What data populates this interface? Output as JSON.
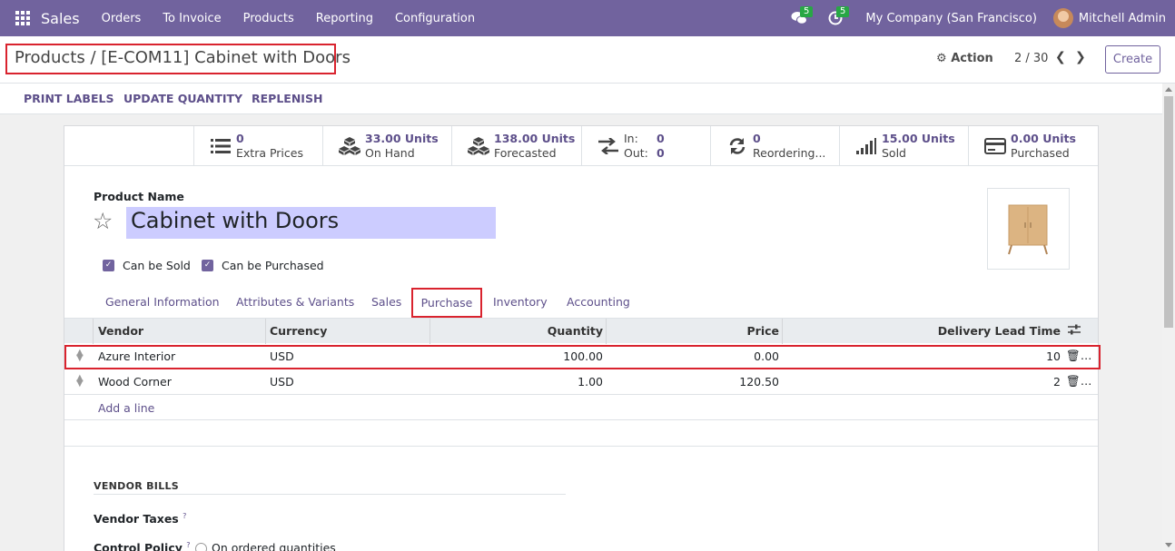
{
  "navbar": {
    "app_name": "Sales",
    "menu": [
      "Orders",
      "To Invoice",
      "Products",
      "Reporting",
      "Configuration"
    ],
    "messages_count": "5",
    "activities_count": "5",
    "company": "My Company (San Francisco)",
    "user": "Mitchell Admin"
  },
  "control": {
    "breadcrumb_parent": "Products",
    "breadcrumb_sep": "/",
    "breadcrumb_current": "[E-COM11] Cabinet with Doors",
    "action_label": "Action",
    "pager": "2 / 30",
    "create_label": "Create"
  },
  "statusbar": {
    "buttons": [
      "PRINT LABELS",
      "UPDATE QUANTITY",
      "REPLENISH"
    ]
  },
  "smart_buttons": [
    {
      "value": "0",
      "label": "Extra Prices",
      "icon": "list-icon"
    },
    {
      "value": "33.00 Units",
      "label": "On Hand",
      "icon": "cubes-icon"
    },
    {
      "value": "138.00 Units",
      "label": "Forecasted",
      "icon": "cubes-icon"
    },
    {
      "in_label": "In:",
      "in_value": "0",
      "out_label": "Out:",
      "out_value": "0",
      "icon": "exchange-icon"
    },
    {
      "value": "0",
      "label": "Reordering...",
      "icon": "refresh-icon"
    },
    {
      "value": "15.00 Units",
      "label": "Sold",
      "icon": "signal-icon"
    },
    {
      "value": "0.00 Units",
      "label": "Purchased",
      "icon": "credit-card-icon"
    }
  ],
  "form": {
    "product_name_label": "Product Name",
    "product_name": "Cabinet with Doors",
    "can_be_sold": "Can be Sold",
    "can_be_purchased": "Can be Purchased"
  },
  "tabs": [
    "General Information",
    "Attributes & Variants",
    "Sales",
    "Purchase",
    "Inventory",
    "Accounting"
  ],
  "vendor_table": {
    "columns": [
      "Vendor",
      "Currency",
      "Quantity",
      "Price",
      "Delivery Lead Time"
    ],
    "rows": [
      {
        "vendor": "Azure Interior",
        "currency": "USD",
        "quantity": "100.00",
        "price": "0.00",
        "lead_time": "10"
      },
      {
        "vendor": "Wood Corner",
        "currency": "USD",
        "quantity": "1.00",
        "price": "120.50",
        "lead_time": "2"
      }
    ],
    "add_line": "Add a line"
  },
  "vendor_bills": {
    "title": "VENDOR BILLS",
    "taxes_label": "Vendor Taxes",
    "control_policy_label": "Control Policy",
    "help_mark": "?",
    "control_policy_option": "On ordered quantities"
  }
}
